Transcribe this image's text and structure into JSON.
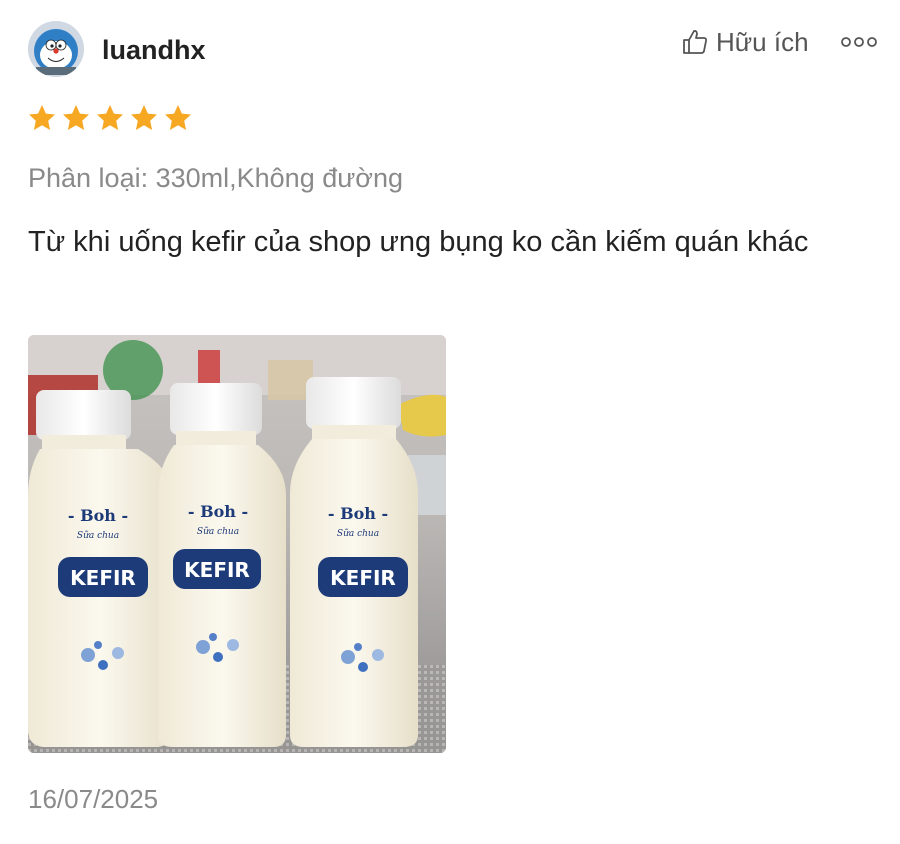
{
  "review": {
    "user": {
      "name": "luandhx",
      "avatar_icon": "cartoon-avatar-icon"
    },
    "helpful": {
      "label": "Hữu ích",
      "icon": "thumbs-up-icon"
    },
    "more_icon": "more-options-icon",
    "rating": {
      "value": 5,
      "max": 5,
      "star_color": "#f7a823"
    },
    "variant": "Phân loại: 330ml,Không đường",
    "comment": "Từ khi uống kefir của shop ưng bụng ko cần kiếm quán khác",
    "photo": {
      "bottles": [
        {
          "brand": "- Boh -",
          "subtitle": "Sữa chua",
          "product": "KEFIR"
        },
        {
          "brand": "- Boh -",
          "subtitle": "Sữa chua",
          "product": "KEFIR"
        },
        {
          "brand": "- Boh -",
          "subtitle": "Sữa chua",
          "product": "KEFIR"
        }
      ]
    },
    "date": "16/07/2025"
  }
}
